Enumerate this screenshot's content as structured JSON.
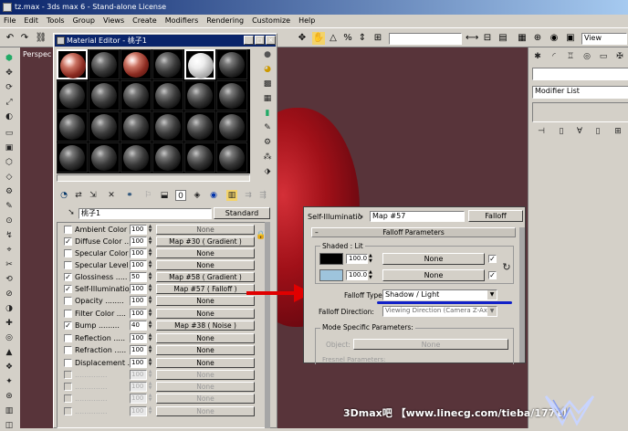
{
  "app": {
    "title": "tz.max - 3ds max 6 - Stand-alone License",
    "viewport_label": "Perspec"
  },
  "menu": [
    "File",
    "Edit",
    "Tools",
    "Group",
    "Views",
    "Create",
    "Modifiers",
    "Rendering",
    "Customize",
    "Help"
  ],
  "toolbar": {
    "view_select": "View"
  },
  "material_editor": {
    "title": "Material Editor - 桃子1",
    "material_name": "桃子1",
    "type_button": "Standard",
    "maps": [
      {
        "label": "Ambient Color ..",
        "checked": false,
        "amount": "100",
        "map": "None",
        "enabled": true
      },
      {
        "label": "Diffuse Color ...",
        "checked": true,
        "amount": "100",
        "map": "Map #30 ( Gradient )",
        "enabled": true
      },
      {
        "label": "Specular Color ..",
        "checked": false,
        "amount": "100",
        "map": "None",
        "enabled": true
      },
      {
        "label": "Specular Level ...",
        "checked": false,
        "amount": "100",
        "map": "None",
        "enabled": true
      },
      {
        "label": "Glossiness .....",
        "checked": true,
        "amount": "50",
        "map": "Map #58 ( Gradient )",
        "enabled": true
      },
      {
        "label": "Self-Illumination .",
        "checked": true,
        "amount": "100",
        "map": "Map #57 ( Falloff )",
        "enabled": true
      },
      {
        "label": "Opacity ........",
        "checked": false,
        "amount": "100",
        "map": "None",
        "enabled": true
      },
      {
        "label": "Filter Color ....",
        "checked": false,
        "amount": "100",
        "map": "None",
        "enabled": true
      },
      {
        "label": "Bump .........",
        "checked": true,
        "amount": "40",
        "map": "Map #38 ( Noise )",
        "enabled": true
      },
      {
        "label": "Reflection .....",
        "checked": false,
        "amount": "100",
        "map": "None",
        "enabled": true
      },
      {
        "label": "Refraction .....",
        "checked": false,
        "amount": "100",
        "map": "None",
        "enabled": true
      },
      {
        "label": "Displacement ...",
        "checked": false,
        "amount": "100",
        "map": "None",
        "enabled": true
      },
      {
        "label": "..............",
        "checked": false,
        "amount": "100",
        "map": "None",
        "enabled": false
      },
      {
        "label": "..............",
        "checked": false,
        "amount": "100",
        "map": "None",
        "enabled": false
      },
      {
        "label": "..............",
        "checked": false,
        "amount": "100",
        "map": "None",
        "enabled": false
      },
      {
        "label": "..............",
        "checked": false,
        "amount": "100",
        "map": "None",
        "enabled": false
      }
    ]
  },
  "command_panel": {
    "modifier_list": "Modifier List"
  },
  "falloff": {
    "slot_label": "Self-Illuminatio",
    "map_name": "Map #57",
    "type_button": "Falloff",
    "rollout_title": "Falloff Parameters",
    "shaded_lit": "Shaded : Lit",
    "row1": {
      "amount": "100.0",
      "map": "None"
    },
    "row2": {
      "amount": "100.0",
      "map": "None"
    },
    "falloff_type_label": "Falloff Type:",
    "falloff_type_value": "Shadow / Light",
    "falloff_direction_label": "Falloff Direction:",
    "falloff_direction_value": "Viewing Direction (Camera Z-Axis)",
    "mode_section": "Mode Specific Parameters:",
    "object_label": "Object:",
    "object_value": "None",
    "fresnel_label": "Fresnel Parameters:"
  },
  "watermark": "3Dmax吧 【www.linecg.com/tieba/1771】",
  "colors": {
    "viewport": "#58343a",
    "red_object": "#a01018",
    "arrow": "#e00000",
    "underline": "#1020c8",
    "title_bar": "#0a246a"
  }
}
